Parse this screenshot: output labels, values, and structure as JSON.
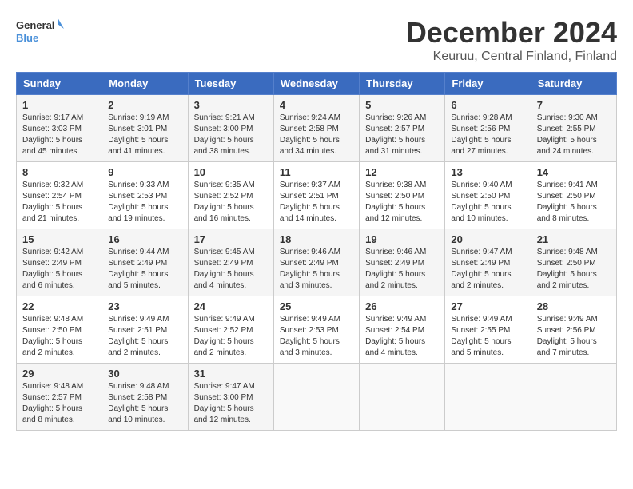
{
  "header": {
    "logo_general": "General",
    "logo_blue": "Blue",
    "title": "December 2024",
    "subtitle": "Keuruu, Central Finland, Finland"
  },
  "calendar": {
    "days_of_week": [
      "Sunday",
      "Monday",
      "Tuesday",
      "Wednesday",
      "Thursday",
      "Friday",
      "Saturday"
    ],
    "weeks": [
      [
        {
          "day": "1",
          "sunrise": "9:17 AM",
          "sunset": "3:03 PM",
          "daylight": "5 hours and 45 minutes."
        },
        {
          "day": "2",
          "sunrise": "9:19 AM",
          "sunset": "3:01 PM",
          "daylight": "5 hours and 41 minutes."
        },
        {
          "day": "3",
          "sunrise": "9:21 AM",
          "sunset": "3:00 PM",
          "daylight": "5 hours and 38 minutes."
        },
        {
          "day": "4",
          "sunrise": "9:24 AM",
          "sunset": "2:58 PM",
          "daylight": "5 hours and 34 minutes."
        },
        {
          "day": "5",
          "sunrise": "9:26 AM",
          "sunset": "2:57 PM",
          "daylight": "5 hours and 31 minutes."
        },
        {
          "day": "6",
          "sunrise": "9:28 AM",
          "sunset": "2:56 PM",
          "daylight": "5 hours and 27 minutes."
        },
        {
          "day": "7",
          "sunrise": "9:30 AM",
          "sunset": "2:55 PM",
          "daylight": "5 hours and 24 minutes."
        }
      ],
      [
        {
          "day": "8",
          "sunrise": "9:32 AM",
          "sunset": "2:54 PM",
          "daylight": "5 hours and 21 minutes."
        },
        {
          "day": "9",
          "sunrise": "9:33 AM",
          "sunset": "2:53 PM",
          "daylight": "5 hours and 19 minutes."
        },
        {
          "day": "10",
          "sunrise": "9:35 AM",
          "sunset": "2:52 PM",
          "daylight": "5 hours and 16 minutes."
        },
        {
          "day": "11",
          "sunrise": "9:37 AM",
          "sunset": "2:51 PM",
          "daylight": "5 hours and 14 minutes."
        },
        {
          "day": "12",
          "sunrise": "9:38 AM",
          "sunset": "2:50 PM",
          "daylight": "5 hours and 12 minutes."
        },
        {
          "day": "13",
          "sunrise": "9:40 AM",
          "sunset": "2:50 PM",
          "daylight": "5 hours and 10 minutes."
        },
        {
          "day": "14",
          "sunrise": "9:41 AM",
          "sunset": "2:50 PM",
          "daylight": "5 hours and 8 minutes."
        }
      ],
      [
        {
          "day": "15",
          "sunrise": "9:42 AM",
          "sunset": "2:49 PM",
          "daylight": "5 hours and 6 minutes."
        },
        {
          "day": "16",
          "sunrise": "9:44 AM",
          "sunset": "2:49 PM",
          "daylight": "5 hours and 5 minutes."
        },
        {
          "day": "17",
          "sunrise": "9:45 AM",
          "sunset": "2:49 PM",
          "daylight": "5 hours and 4 minutes."
        },
        {
          "day": "18",
          "sunrise": "9:46 AM",
          "sunset": "2:49 PM",
          "daylight": "5 hours and 3 minutes."
        },
        {
          "day": "19",
          "sunrise": "9:46 AM",
          "sunset": "2:49 PM",
          "daylight": "5 hours and 2 minutes."
        },
        {
          "day": "20",
          "sunrise": "9:47 AM",
          "sunset": "2:49 PM",
          "daylight": "5 hours and 2 minutes."
        },
        {
          "day": "21",
          "sunrise": "9:48 AM",
          "sunset": "2:50 PM",
          "daylight": "5 hours and 2 minutes."
        }
      ],
      [
        {
          "day": "22",
          "sunrise": "9:48 AM",
          "sunset": "2:50 PM",
          "daylight": "5 hours and 2 minutes."
        },
        {
          "day": "23",
          "sunrise": "9:49 AM",
          "sunset": "2:51 PM",
          "daylight": "5 hours and 2 minutes."
        },
        {
          "day": "24",
          "sunrise": "9:49 AM",
          "sunset": "2:52 PM",
          "daylight": "5 hours and 2 minutes."
        },
        {
          "day": "25",
          "sunrise": "9:49 AM",
          "sunset": "2:53 PM",
          "daylight": "5 hours and 3 minutes."
        },
        {
          "day": "26",
          "sunrise": "9:49 AM",
          "sunset": "2:54 PM",
          "daylight": "5 hours and 4 minutes."
        },
        {
          "day": "27",
          "sunrise": "9:49 AM",
          "sunset": "2:55 PM",
          "daylight": "5 hours and 5 minutes."
        },
        {
          "day": "28",
          "sunrise": "9:49 AM",
          "sunset": "2:56 PM",
          "daylight": "5 hours and 7 minutes."
        }
      ],
      [
        {
          "day": "29",
          "sunrise": "9:48 AM",
          "sunset": "2:57 PM",
          "daylight": "5 hours and 8 minutes."
        },
        {
          "day": "30",
          "sunrise": "9:48 AM",
          "sunset": "2:58 PM",
          "daylight": "5 hours and 10 minutes."
        },
        {
          "day": "31",
          "sunrise": "9:47 AM",
          "sunset": "3:00 PM",
          "daylight": "5 hours and 12 minutes."
        },
        null,
        null,
        null,
        null
      ]
    ]
  }
}
